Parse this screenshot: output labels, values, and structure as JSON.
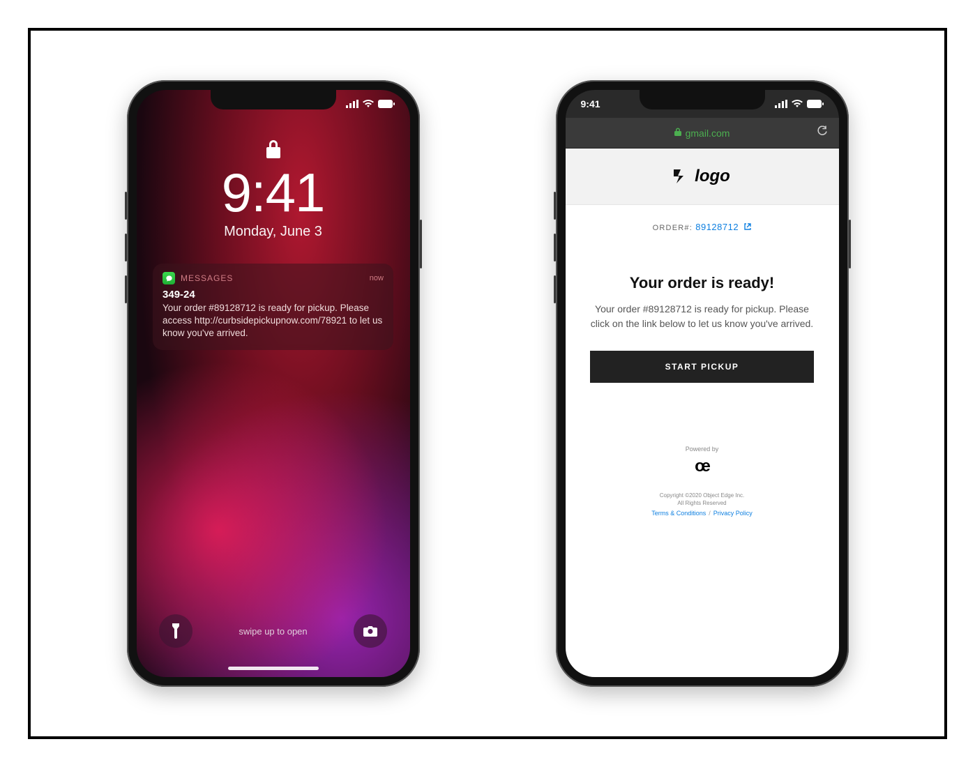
{
  "lockscreen": {
    "time": "9:41",
    "date": "Monday, June 3",
    "notification": {
      "app_label": "MESSAGES",
      "when": "now",
      "sender": "349-24",
      "body": "Your order #89128712 is ready for pickup. Please access http://curbsidepickupnow.com/78921 to let us know you've arrived."
    },
    "swipe_text": "swipe up to open"
  },
  "email": {
    "status_time": "9:41",
    "url": "gmail.com",
    "logo_text": "logo",
    "order_label": "ORDER#:",
    "order_number": "89128712",
    "title": "Your order is ready!",
    "body": "Your order #89128712 is ready for pickup. Please click on the link below to let us know you've arrived.",
    "button_label": "START PICKUP",
    "powered_by_label": "Powered by",
    "oe_mark": "œ",
    "copyright_line1": "Copyright ©2020 Object Edge Inc.",
    "copyright_line2": "All Rights Reserved",
    "terms_label": "Terms & Conditions",
    "privacy_label": "Privacy Policy"
  }
}
